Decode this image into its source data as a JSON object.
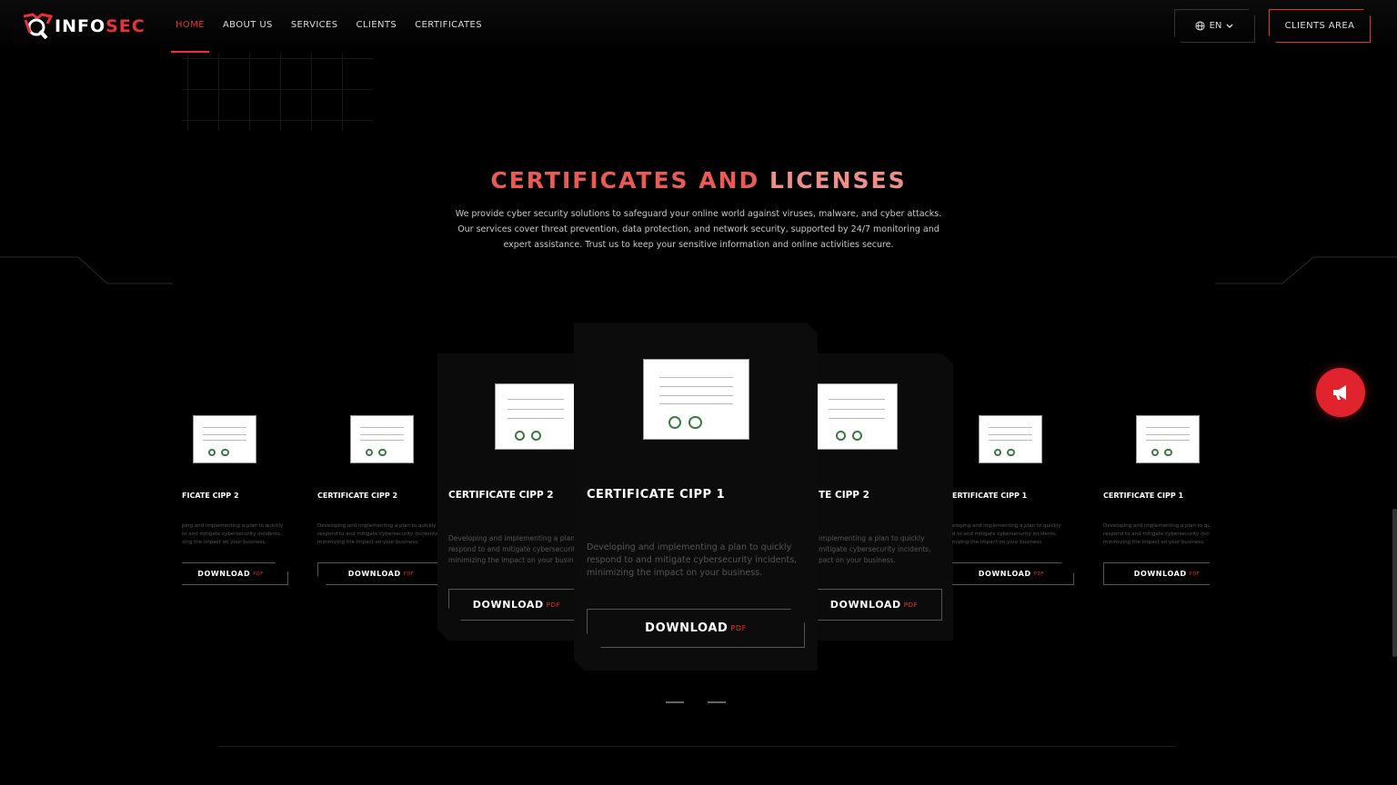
{
  "brand": {
    "part1": "INFO",
    "part2": "SEC",
    "accent": "#e8313a"
  },
  "nav": {
    "items": [
      {
        "label": "HOME",
        "active": true
      },
      {
        "label": "ABOUT US",
        "active": false
      },
      {
        "label": "SERVICES",
        "active": false
      },
      {
        "label": "CLIENTS",
        "active": false
      },
      {
        "label": "CERTIFICATES",
        "active": false
      }
    ]
  },
  "header": {
    "lang": "EN",
    "lang_icon": "globe-icon",
    "clients_area": "CLIENTS AREA"
  },
  "section": {
    "title_part1": "CERTIFICATES AND",
    "title_part2": "LICENSES",
    "description": "We provide cyber security solutions to safeguard your online world against viruses, malware, and cyber attacks. Our services cover threat prevention, data protection, and network security, supported by 24/7 monitoring and expert assistance. Trust us to keep your sensitive information and online activities secure."
  },
  "cards": [
    {
      "name": "FICATE CIPP 2",
      "text": "ping and implementing a plan to quickly\nto and mitigate cybersecurity incidents,\nzing the impact on your business.",
      "button": "DOWNLOAD",
      "pdf": "PDF"
    },
    {
      "name": "CERTIFICATE CIPP 2",
      "text": "Developing and implementing a plan to quickly\nrespond to and mitigate cybersecurity incidents,\nminimizing the impact on your business.",
      "button": "DOWNLOAD",
      "pdf": "PDF"
    },
    {
      "name": "CERTIFICATE CIPP 2",
      "text": "Developing and implementing a plan to quickly\nrespond to and mitigate cybersecurity incidents,\nminimizing the impact on your business.",
      "button": "DOWNLOAD",
      "pdf": "PDF"
    },
    {
      "name": "CERTIFICATE CIPP 1",
      "text": "Developing and implementing a plan to quickly\nrespond to and mitigate cybersecurity incidents,\nminimizing the impact on your business.",
      "button": "DOWNLOAD",
      "pdf": "PDF"
    },
    {
      "name": "TE CIPP 2",
      "text": "implementing a plan to quickly\nmitigate cybersecurity incidents,\npact on your business.",
      "button": "DOWNLOAD",
      "pdf": "PDF"
    },
    {
      "name": "ERTIFICATE CIPP 1",
      "text": "eloping and implementing a plan to quickly\nd to and mitigate cybersecurity incidents,\nmizing the impact on your business.",
      "button": "DOWNLOAD",
      "pdf": "PDF"
    },
    {
      "name": "CERTIFICATE CIPP 1",
      "text": "Developing and implementing a plan to quickly\nrespond to and mitigate cybersecurity incidents,\nminimizing the impact on your business.",
      "button": "DOWNLOAD",
      "pdf": "PDF"
    }
  ],
  "fab_icon": "megaphone-icon"
}
